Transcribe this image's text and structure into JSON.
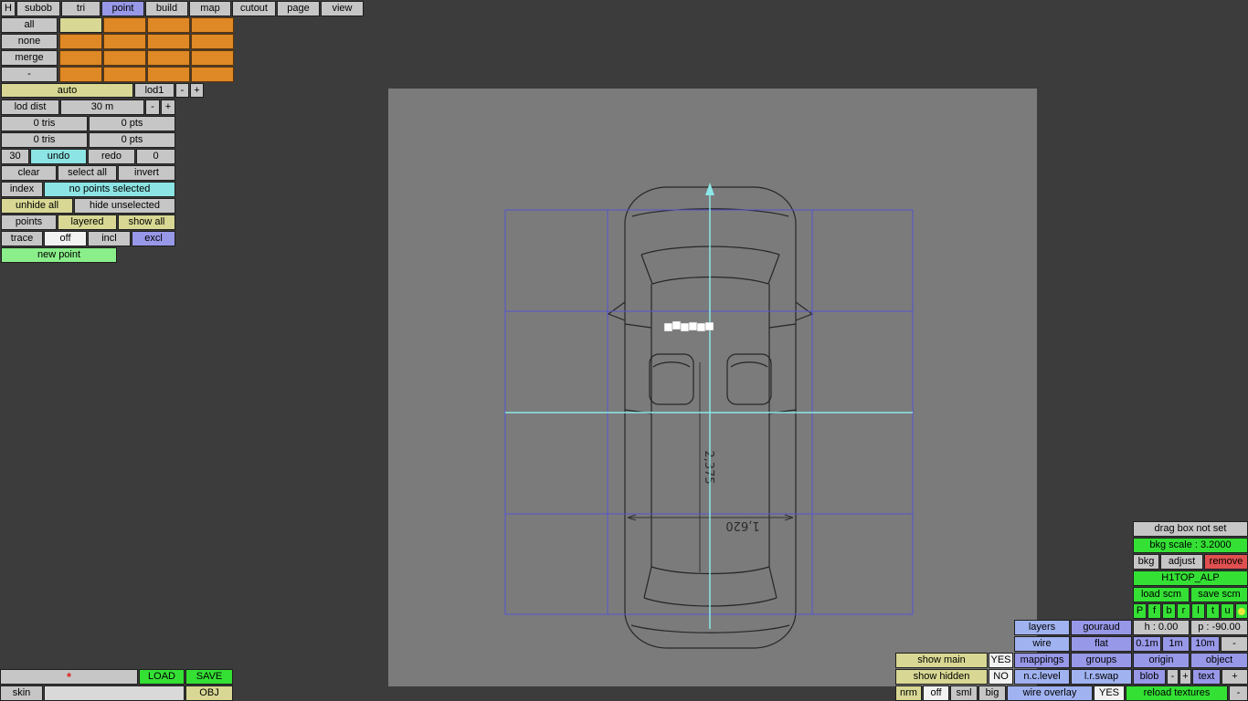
{
  "menubar": [
    "H",
    "subob",
    "tri",
    "point",
    "build",
    "map",
    "cutout",
    "page",
    "view"
  ],
  "left_panel": {
    "subobject_buttons": [
      "all",
      "none",
      "merge",
      "-"
    ],
    "auto_row": [
      "auto",
      "lod1",
      "-",
      "+"
    ],
    "lod_row": [
      "lod dist",
      "30 m",
      "-",
      "+"
    ],
    "stats_row1": [
      "0 tris",
      "0 pts"
    ],
    "stats_row2": [
      "0 tris",
      "0 pts"
    ],
    "history_row": [
      "30",
      "undo",
      "redo",
      "0"
    ],
    "select_row": [
      "clear",
      "select all",
      "invert"
    ],
    "index_row": [
      "index",
      "no points selected"
    ],
    "hide_row": [
      "unhide all",
      "hide unselected"
    ],
    "points_row": [
      "points",
      "layered",
      "show all"
    ],
    "trace_row": [
      "trace",
      "off",
      "incl",
      "excl"
    ],
    "new_point_label": "new point"
  },
  "file_bar": {
    "modified_marker": "*",
    "load": "LOAD",
    "save": "SAVE",
    "skin": "skin",
    "filename": "",
    "obj": "OBJ"
  },
  "viewport": {
    "dim_length": "2,375",
    "dim_width": "1,620"
  },
  "right_panel": {
    "drag_box_status": "drag box not set",
    "bkg_scale": "bkg scale : 3.2000",
    "bkg_row": [
      "bkg",
      "adjust",
      "remove"
    ],
    "texture_name": "H1TOP_ALP",
    "scm_row": [
      "load scm",
      "save scm"
    ],
    "view_presets": [
      "P",
      "f",
      "b",
      "r",
      "l",
      "t",
      "u"
    ],
    "render_row1": [
      "layers",
      "gouraud",
      "h : 0.00",
      "p : -90.00"
    ],
    "render_row2": [
      "wire",
      "flat",
      "0.1m",
      "1m",
      "10m",
      "-"
    ],
    "show_main_row": [
      "show main",
      "YES",
      "mappings",
      "groups",
      "origin",
      "object"
    ],
    "show_hidden_row": [
      "show hidden",
      "NO",
      "n.c.level",
      "l.r.swap",
      "blob",
      "-",
      "+",
      "text",
      "+"
    ],
    "misc_row": [
      "nrm",
      "off",
      "sml",
      "big",
      "wire overlay",
      "YES",
      "reload textures",
      "-"
    ]
  },
  "colors": {
    "accent_purple": "#9898e8",
    "cyan": "#8de4e4",
    "tan": "#d8d894",
    "orange": "#de8826",
    "green": "#34e034",
    "light_green": "#8aee8a",
    "red": "#e05050",
    "periwinkle": "#a0b2f0",
    "grid_blue": "#5555d0",
    "axis_cyan": "#8ce8e8",
    "canvas_gray": "#7b7b7b"
  }
}
